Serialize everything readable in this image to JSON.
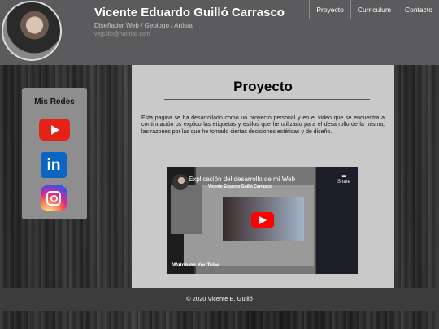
{
  "header": {
    "name": "Vicente Eduardo Guilló Carrasco",
    "subtitle": "Diseñador Web / Geologo / Artista",
    "email": "veguillo@hotmail.com",
    "background_color": "#5b5b5d"
  },
  "nav": {
    "items": [
      {
        "label": "Proyecto"
      },
      {
        "label": "Curriculum"
      },
      {
        "label": "Contacto"
      }
    ]
  },
  "social": {
    "title": "Mis Redes",
    "icons": [
      "youtube-icon",
      "linkedin-icon",
      "instagram-icon"
    ],
    "linkedin_glyph": "in"
  },
  "main": {
    "title": "Proyecto",
    "paragraph": "Esta pagina se ha desarrollado como un proyecto personal y en el video que se encuentra a continuación os explico las etiquetas y estilos que he utilizado para el desarrollo de la misma, las razones por las que he tomado ciertas decisiones estéticas y de diseño."
  },
  "video": {
    "title": "Explicación del desarrollo de mi Web",
    "channel": "Vicente Eduardo Guilló Carrasco",
    "share_label": "Share",
    "watch_on": "Watch on",
    "platform": "YouTube"
  },
  "footer": {
    "text": "© 2020 Vicente E. Guilló"
  },
  "colors": {
    "main_panel": "#c9c9c9",
    "sidebar_panel": "#8e8e8e",
    "footer": "#3d3d3d"
  }
}
